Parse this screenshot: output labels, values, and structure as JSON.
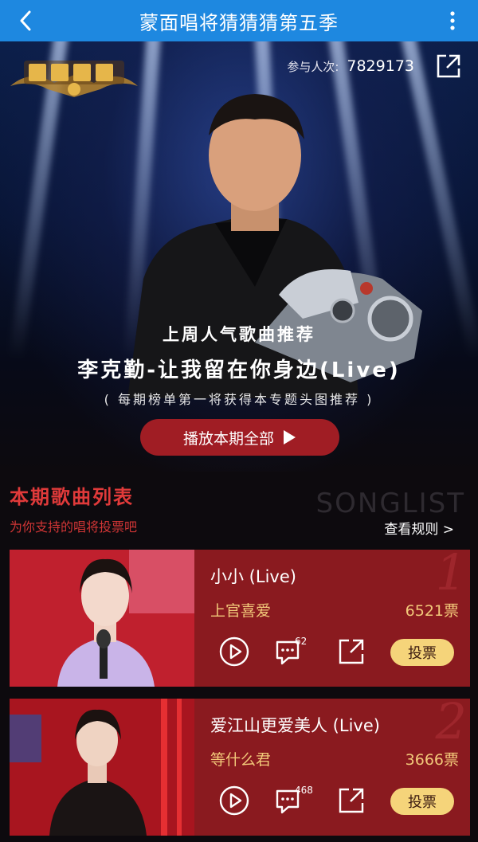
{
  "nav": {
    "title": "蒙面唱将猜猜猜第五季"
  },
  "hero": {
    "participants_label": "参与人次:",
    "participants_count": "7829173",
    "promo_subtitle": "上周人气歌曲推荐",
    "promo_title": "李克勤-让我留在你身边(Live)",
    "promo_note": "( 每期榜单第一将获得本专题头图推荐 )",
    "play_all_label": "播放本期全部"
  },
  "section": {
    "title": "本期歌曲列表",
    "subtitle": "为你支持的唱将投票吧",
    "watermark": "SONGLIST",
    "rules_link": "查看规则 >"
  },
  "songs": [
    {
      "rank": "1",
      "title": "小小 (Live)",
      "artist": "上官喜爱",
      "votes": "6521票",
      "comments": "62",
      "vote_label": "投票"
    },
    {
      "rank": "2",
      "title": "爱江山更爱美人 (Live)",
      "artist": "等什么君",
      "votes": "3666票",
      "comments": "468",
      "vote_label": "投票"
    }
  ],
  "colors": {
    "nav_bg": "#1e88e0",
    "accent_red": "#a01d24",
    "card_bg": "#8a1a1f",
    "vote_btn": "#f5d47a",
    "gold_text": "#f2c97a"
  }
}
